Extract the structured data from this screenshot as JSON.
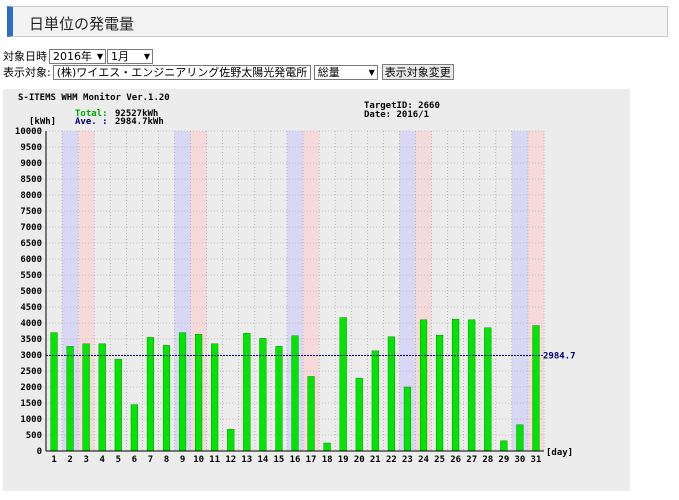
{
  "page": {
    "title": "日単位の発電量"
  },
  "controls": {
    "date_label": "対象日時",
    "year_value": "2016年",
    "month_value": "1月",
    "target_label": "表示対象:",
    "facility_value": "(株)ワイエス・エンジニアリング佐野太陽光発電所",
    "metric_value": "総量",
    "change_button": "表示対象変更"
  },
  "chart_header": {
    "monitor": "S-ITEMS WHM Monitor Ver.1.20",
    "unit": "[kWh]",
    "total_label": "Total:",
    "total_value": "92527kWh",
    "ave_label": "Ave.  :",
    "ave_value": "2984.7kWh",
    "target_id": "TargetID: 2660",
    "date": "Date: 2016/1",
    "x_unit": "[day]",
    "avg_label": "2984.7"
  },
  "colors": {
    "bar": "#00e600",
    "bar_edge": "#007a00",
    "saturday_band": "#d8d8f4",
    "sunday_band": "#f6dada",
    "average_line": "#00007a",
    "total_text": "#00aa00",
    "ave_text": "#00007a"
  },
  "chart_data": {
    "type": "bar",
    "xlabel": "[day]",
    "ylabel": "[kWh]",
    "ylim": [
      0,
      10000
    ],
    "yticks": [
      0,
      500,
      1000,
      1500,
      2000,
      2500,
      3000,
      3500,
      4000,
      4500,
      5000,
      5500,
      6000,
      6500,
      7000,
      7500,
      8000,
      8500,
      9000,
      9500,
      10000
    ],
    "categories": [
      "1",
      "2",
      "3",
      "4",
      "5",
      "6",
      "7",
      "8",
      "9",
      "10",
      "11",
      "12",
      "13",
      "14",
      "15",
      "16",
      "17",
      "18",
      "19",
      "20",
      "21",
      "22",
      "23",
      "24",
      "25",
      "26",
      "27",
      "28",
      "29",
      "30",
      "31"
    ],
    "values": [
      3700,
      3270,
      3350,
      3350,
      2870,
      1450,
      3550,
      3300,
      3700,
      3650,
      3350,
      680,
      3680,
      3520,
      3270,
      3600,
      2330,
      250,
      4170,
      2280,
      3130,
      3570,
      2000,
      4100,
      3620,
      4120,
      4100,
      3850,
      320,
      820,
      3920
    ],
    "saturday_days": [
      2,
      9,
      16,
      23,
      30
    ],
    "sunday_days": [
      3,
      10,
      17,
      24,
      31
    ],
    "average": 2984.7,
    "total": 92527
  }
}
